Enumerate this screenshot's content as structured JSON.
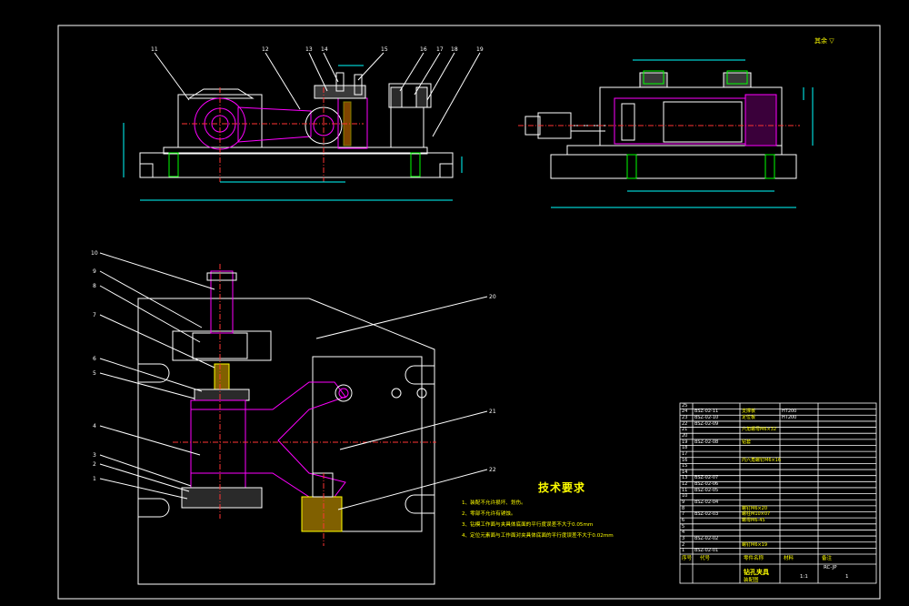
{
  "roughness_note": "其余 ▽",
  "tech_requirements": {
    "title": "技术要求",
    "items": [
      "1、装配不允许损坏、划伤。",
      "2、零部不允许有锈蚀。",
      "3、钻模工作面与夹具体底面的平行度误差不大于0.05mm",
      "4、定位元素面与工作面对夹具体底面的平行度误差不大于0.02mm"
    ]
  },
  "balloons": {
    "front": [
      "11",
      "12",
      "13",
      "14",
      "15",
      "16",
      "17",
      "18",
      "19"
    ],
    "plan": [
      "10",
      "9",
      "8",
      "7",
      "6",
      "5",
      "4",
      "3",
      "2",
      "1",
      "20",
      "21",
      "22"
    ]
  },
  "bom": {
    "rows": [
      {
        "no": "25",
        "code": "",
        "name": "",
        "material": "",
        "remark": ""
      },
      {
        "no": "24",
        "code": "BSZ-02-11",
        "name": "支撑板",
        "material": "HT200",
        "remark": ""
      },
      {
        "no": "23",
        "code": "BSZ-02-10",
        "name": "定位板",
        "material": "HT200",
        "remark": ""
      },
      {
        "no": "22",
        "code": "BSZ-02-09",
        "name": "",
        "material": "",
        "remark": ""
      },
      {
        "no": "21",
        "code": "",
        "name": "六角螺母M6×32",
        "material": "",
        "remark": ""
      },
      {
        "no": "20",
        "code": "",
        "name": "",
        "material": "",
        "remark": ""
      },
      {
        "no": "19",
        "code": "BSZ-02-08",
        "name": "钻套",
        "material": "",
        "remark": ""
      },
      {
        "no": "18",
        "code": "",
        "name": "",
        "material": "",
        "remark": ""
      },
      {
        "no": "17",
        "code": "",
        "name": "",
        "material": "",
        "remark": ""
      },
      {
        "no": "16",
        "code": "",
        "name": "内六角螺钉M6×16",
        "material": "",
        "remark": ""
      },
      {
        "no": "15",
        "code": "",
        "name": "",
        "material": "",
        "remark": ""
      },
      {
        "no": "14",
        "code": "",
        "name": "",
        "material": "",
        "remark": ""
      },
      {
        "no": "13",
        "code": "BSZ-02-07",
        "name": "",
        "material": "",
        "remark": ""
      },
      {
        "no": "12",
        "code": "BSZ-02-06",
        "name": "",
        "material": "",
        "remark": ""
      },
      {
        "no": "11",
        "code": "BSZ-02-05",
        "name": "",
        "material": "",
        "remark": ""
      },
      {
        "no": "10",
        "code": "",
        "name": "",
        "material": "",
        "remark": ""
      },
      {
        "no": "9",
        "code": "BSZ-02-04",
        "name": "",
        "material": "",
        "remark": ""
      },
      {
        "no": "8",
        "code": "",
        "name": "螺钉M6×20",
        "material": "",
        "remark": ""
      },
      {
        "no": "7",
        "code": "BSZ-02-03",
        "name": "螺柱M10×07",
        "material": "",
        "remark": ""
      },
      {
        "no": "6",
        "code": "",
        "name": "螺母M6-45",
        "material": "",
        "remark": ""
      },
      {
        "no": "5",
        "code": "",
        "name": "",
        "material": "",
        "remark": ""
      },
      {
        "no": "4",
        "code": "",
        "name": "",
        "material": "",
        "remark": ""
      },
      {
        "no": "3",
        "code": "BSZ-02-02",
        "name": "",
        "material": "",
        "remark": ""
      },
      {
        "no": "2",
        "code": "",
        "name": "螺钉M6×19",
        "material": "",
        "remark": ""
      },
      {
        "no": "1",
        "code": "BSZ-02-01",
        "name": "",
        "material": "",
        "remark": ""
      }
    ],
    "header": {
      "no": "序号",
      "code": "代号",
      "name": "零件名称",
      "material": "材料",
      "remark": "备注"
    },
    "title": "钻孔夹具",
    "drawing_no": "RC-JP",
    "scale": "1:1",
    "sheet": "1",
    "assembly": "装配图"
  }
}
